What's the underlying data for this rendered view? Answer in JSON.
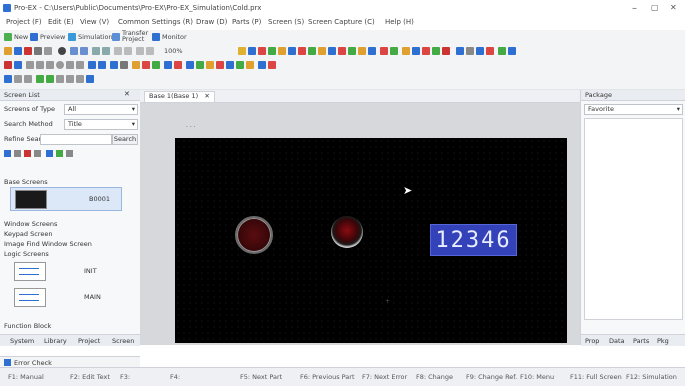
{
  "window": {
    "title": "Pro-EX - C:\\Users\\Public\\Documents\\Pro-EX\\Pro-EX_Simulation\\Cold.prx",
    "minimize_glyph": "–",
    "maximize_glyph": "▢",
    "close_glyph": "✕"
  },
  "menu": [
    "Project (F)",
    "Edit (E)",
    "View (V)",
    "Common Settings (R)",
    "Draw (D)",
    "Parts (P)",
    "Screen (S)",
    "Screen Capture (C)",
    "Help (H)"
  ],
  "toolbar_labels": {
    "new": "New",
    "preview": "Preview",
    "simulation": "Simulation",
    "transfer": "Transfer Project",
    "monitor": "Monitor",
    "zoom": "100%"
  },
  "screen_list": {
    "header": "Screen List",
    "type_label": "Screens of Type",
    "type_value": "All",
    "method_label": "Search Method",
    "method_value": "Title",
    "refine_label": "Refine Search",
    "search_btn": "Search",
    "items": [
      "Base Screens",
      "Window Screens",
      "Keypad Screen",
      "Image Find Window Screen",
      "Logic Screens",
      "Function Block"
    ],
    "base_thumb_label": "B0001",
    "logic_thumbs": [
      "INIT",
      "MAIN"
    ]
  },
  "bottom_tabs": [
    "System",
    "Library",
    "Project",
    "Screen"
  ],
  "error_check": "Error Check",
  "editor_tab": "Base 1(Base 1)",
  "canvas": {
    "display_value": "12346",
    "bg_color": "#000000",
    "display_color": "#3342b8"
  },
  "right_panel": {
    "header": "Package",
    "favorites": "Favorite"
  },
  "right_bottom_tabs": [
    "Prop",
    "Data",
    "Parts",
    "Pkg"
  ],
  "function_keys": [
    "F1: Manual",
    "F2: Edit Text",
    "F3:",
    "F4:",
    "F5: Next Part",
    "F6: Previous Part",
    "F7: Next Error",
    "F8: Change",
    "F9: Change Ref.",
    "F10: Menu",
    "F11: Full Screen",
    "F12: Simulation"
  ],
  "colors": {
    "accent": "#2f6fd1",
    "background": "#ffffff",
    "canvas_area": "#d6d8dc"
  }
}
